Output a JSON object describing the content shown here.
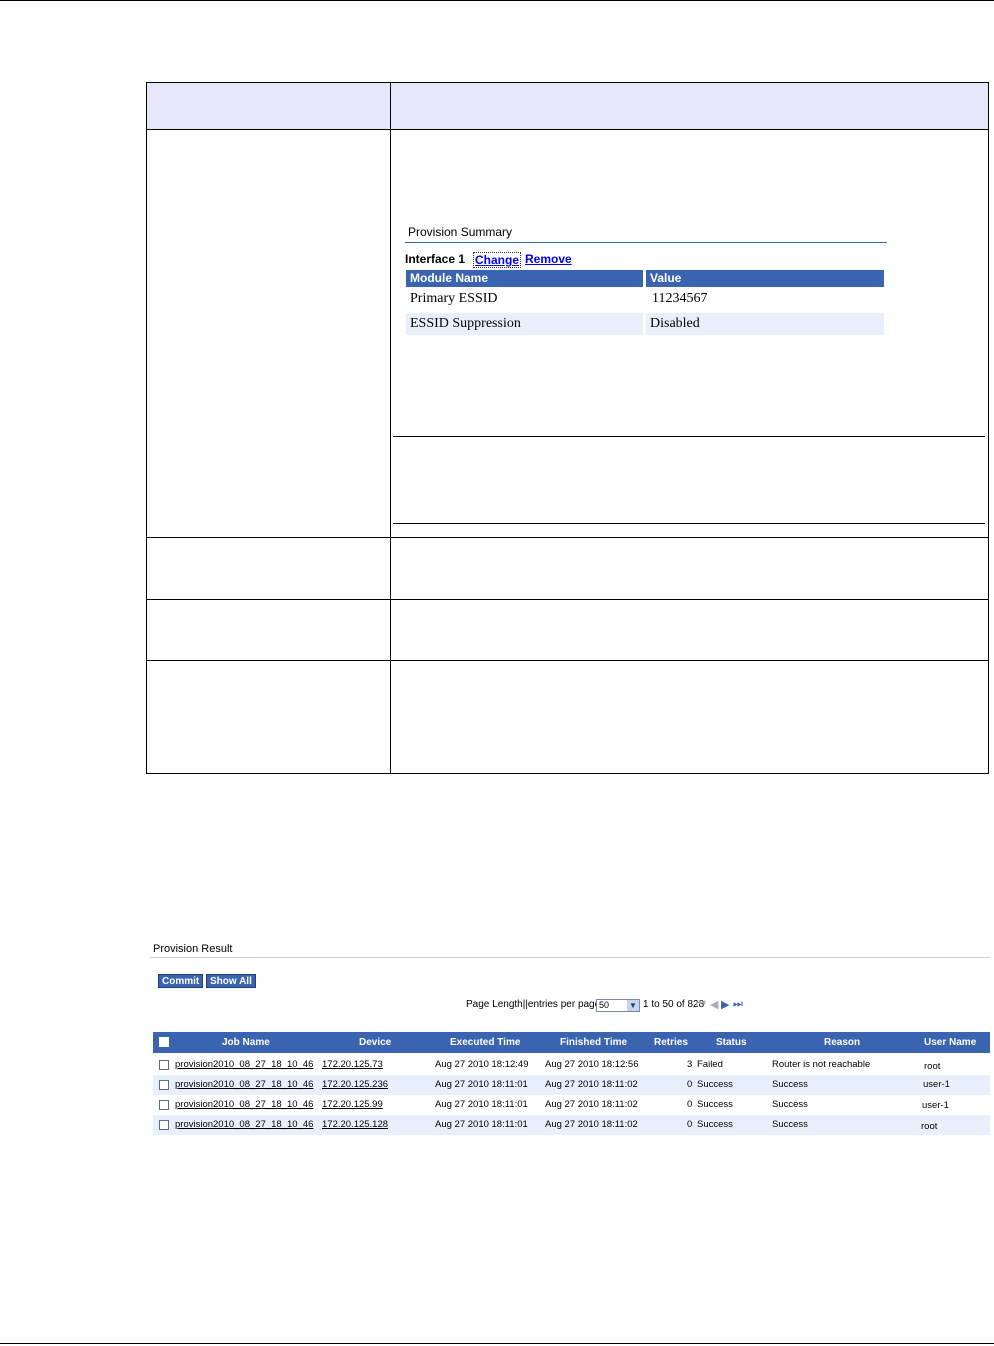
{
  "provision_summary": {
    "title": "Provision Summary",
    "interface_label": "Interface 1",
    "change_link": "Change",
    "remove_link": "Remove",
    "columns": [
      "Module Name",
      "Value"
    ],
    "rows": [
      [
        "Primary ESSID",
        "11234567"
      ],
      [
        "ESSID Suppression",
        "Disabled"
      ]
    ]
  },
  "provision_result": {
    "title": "Provision Result",
    "commit_button": "Commit",
    "show_all_button": "Show All",
    "page_length_label": "Page Length||entries per page",
    "page_length_value": "50",
    "range_text": "1 to 50 of 828",
    "columns": [
      "Job Name",
      "Device",
      "Executed Time",
      "Finished Time",
      "Retries",
      "Status",
      "Reason",
      "User Name"
    ],
    "rows": [
      [
        "provision2010_08_27_18_10_46",
        "172.20.125.73",
        "Aug 27 2010 18:12:49",
        "Aug 27 2010 18:12:56",
        "3",
        "Failed",
        "Router is not reachable",
        "root"
      ],
      [
        "provision2010_08_27_18_10_46",
        "172.20.125.236",
        "Aug 27 2010 18:11:01",
        "Aug 27 2010 18:11:02",
        "0",
        "Success",
        "Success",
        "user-1"
      ],
      [
        "provision2010_08_27_18_10_46",
        "172.20.125.99",
        "Aug 27 2010 18:11:01",
        "Aug 27 2010 18:11:02",
        "0",
        "Success",
        "Success",
        "user-1"
      ],
      [
        "provision2010_08_27_18_10_46",
        "172.20.125.128",
        "Aug 27 2010 18:11:01",
        "Aug 27 2010 18:11:02",
        "0",
        "Success",
        "Success",
        "root"
      ]
    ]
  },
  "colors": {
    "table_header_bg": "#e6e6fa",
    "grid_header_bg": "#3a64b0",
    "alt_row_bg": "#eaf0fb",
    "link": "#0000ee"
  }
}
